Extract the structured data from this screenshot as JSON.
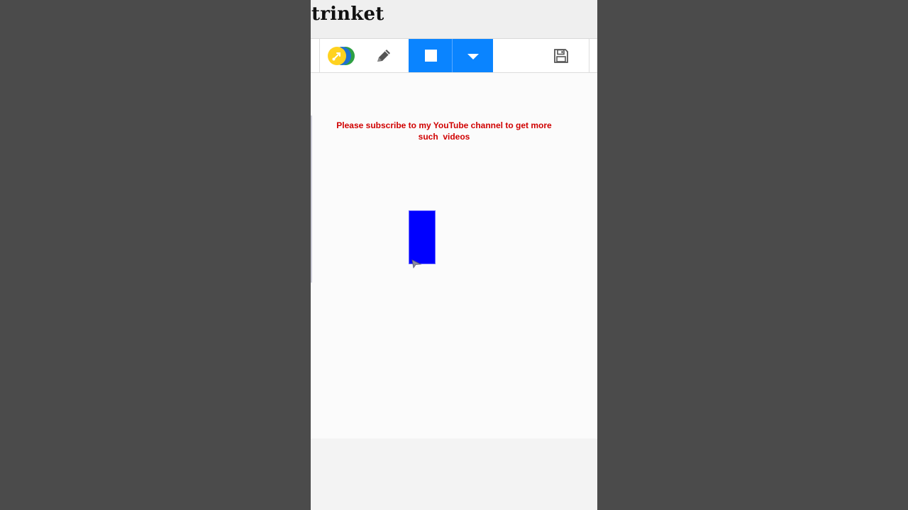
{
  "app": {
    "brand": "trinket"
  },
  "toolbar": {
    "language_icon": "python-logo-icon",
    "edit_icon": "pencil-icon",
    "run_icon": "stop-square-icon",
    "menu_icon": "caret-down-icon",
    "save_icon": "floppy-disk-icon"
  },
  "canvas": {
    "message_line1": "Please subscribe to my YouTube channel to get more",
    "message_line2": "such  videos",
    "message_color": "#d00000",
    "shape_color": "#0000ff",
    "turtle_icon": "turtle-arrow-icon"
  },
  "colors": {
    "accent": "#0a84ff",
    "backdrop": "#4b4b4b"
  }
}
